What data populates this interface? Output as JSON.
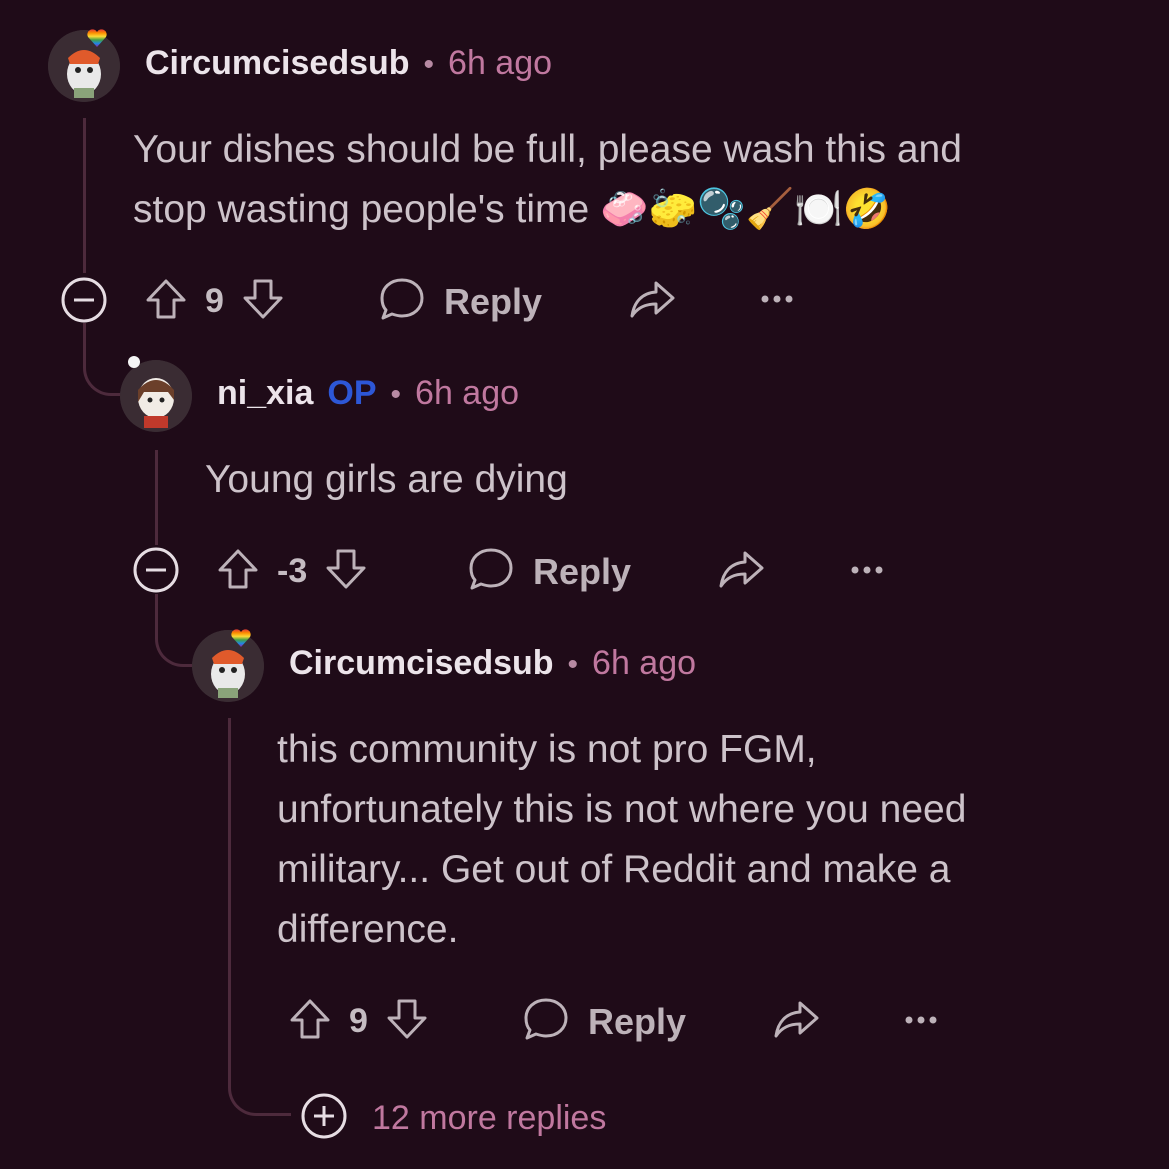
{
  "comments": [
    {
      "username": "Circumcisedsub",
      "separator": "•",
      "time": "6h ago",
      "body": [
        "Your dishes should be full, please wash this and",
        "stop wasting people's time 🧼🧽🫧🧹🍽️🤣"
      ],
      "score": "9",
      "reply_label": "Reply"
    },
    {
      "username": "ni_xia",
      "op_badge": "OP",
      "separator": "•",
      "time": "6h ago",
      "body": [
        "Young girls are dying"
      ],
      "score": "-3",
      "reply_label": "Reply"
    },
    {
      "username": "Circumcisedsub",
      "separator": "•",
      "time": "6h ago",
      "body": [
        "this community is not pro FGM,",
        "unfortunately this is not where you need",
        "military... Get out of Reddit and make a",
        "difference."
      ],
      "score": "9",
      "reply_label": "Reply"
    }
  ],
  "more_replies": "12 more replies",
  "colors": {
    "background": "#1f0b18",
    "username": "#ece4ea",
    "time": "#c0789f",
    "op": "#2d57d6",
    "thread_line": "#4d2a3c"
  },
  "icons": [
    "collapse-icon",
    "upvote-icon",
    "downvote-icon",
    "comment-icon",
    "share-icon",
    "more-icon",
    "expand-icon",
    "pride-heart-icon"
  ]
}
